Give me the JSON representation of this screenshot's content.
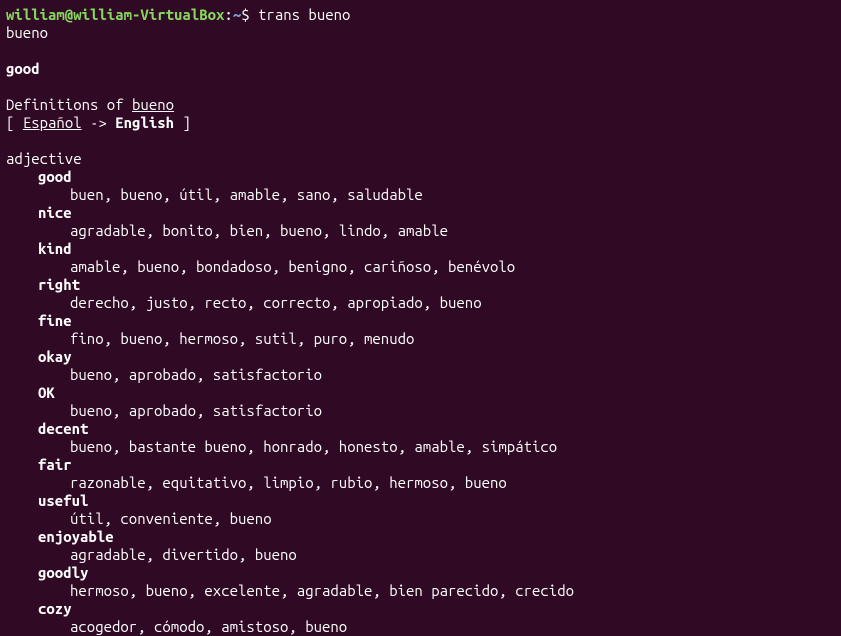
{
  "prompt": {
    "user_host": "william@william-VirtualBox",
    "separator": ":",
    "path": "~",
    "dollar": "$",
    "command": " trans bueno"
  },
  "echo": "bueno",
  "primary_translation": "good",
  "definitions_header": {
    "prefix": "Definitions of ",
    "word": "bueno"
  },
  "lang_line": {
    "open": "[ ",
    "source_lang": "Español",
    "arrow": " -> ",
    "target_lang": "English",
    "close": " ]"
  },
  "part_of_speech": "adjective",
  "entries": [
    {
      "term": "good",
      "synonyms": "buen, bueno, útil, amable, sano, saludable"
    },
    {
      "term": "nice",
      "synonyms": "agradable, bonito, bien, bueno, lindo, amable"
    },
    {
      "term": "kind",
      "synonyms": "amable, bueno, bondadoso, benigno, cariñoso, benévolo"
    },
    {
      "term": "right",
      "synonyms": "derecho, justo, recto, correcto, apropiado, bueno"
    },
    {
      "term": "fine",
      "synonyms": "fino, bueno, hermoso, sutil, puro, menudo"
    },
    {
      "term": "okay",
      "synonyms": "bueno, aprobado, satisfactorio"
    },
    {
      "term": "OK",
      "synonyms": "bueno, aprobado, satisfactorio"
    },
    {
      "term": "decent",
      "synonyms": "bueno, bastante bueno, honrado, honesto, amable, simpático"
    },
    {
      "term": "fair",
      "synonyms": "razonable, equitativo, limpio, rubio, hermoso, bueno"
    },
    {
      "term": "useful",
      "synonyms": "útil, conveniente, bueno"
    },
    {
      "term": "enjoyable",
      "synonyms": "agradable, divertido, bueno"
    },
    {
      "term": "goodly",
      "synonyms": "hermoso, bueno, excelente, agradable, bien parecido, crecido"
    },
    {
      "term": "cozy",
      "synonyms": "acogedor, cómodo, amistoso, bueno"
    }
  ]
}
